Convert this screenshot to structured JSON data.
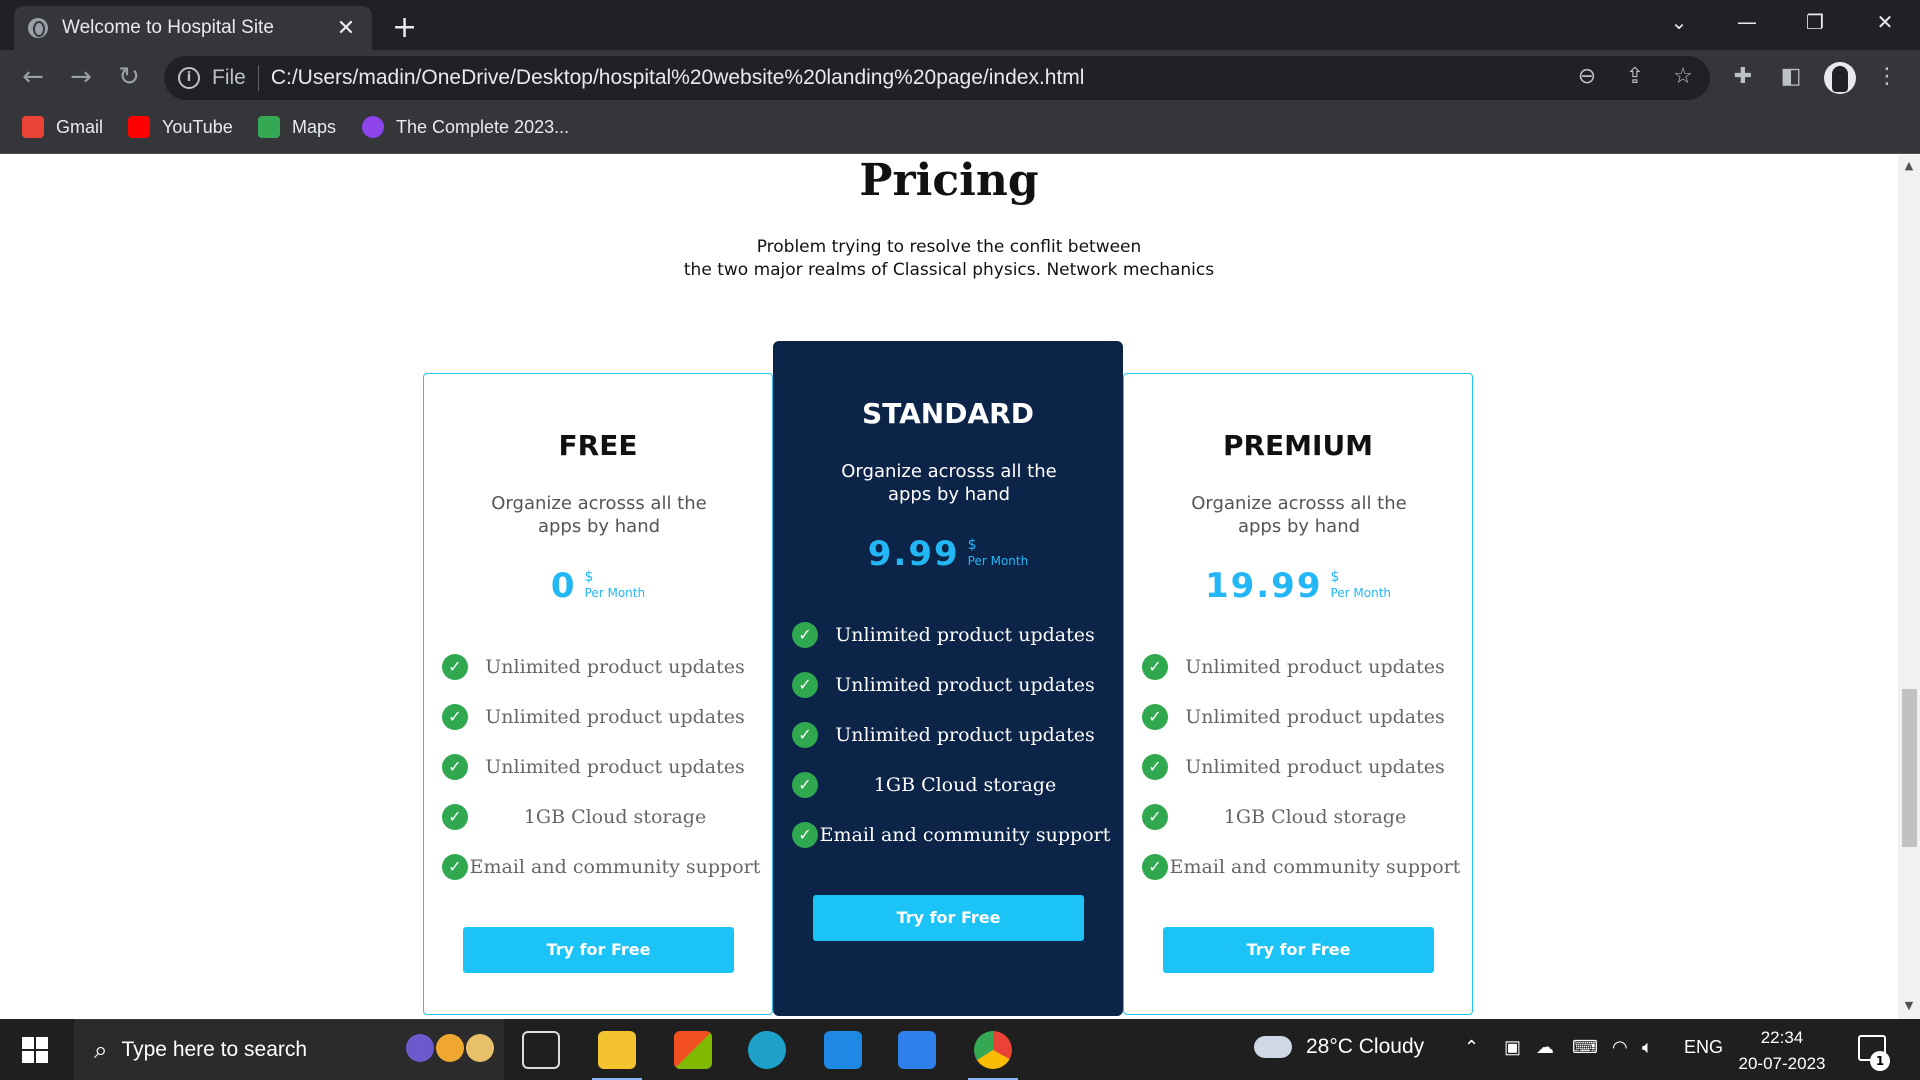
{
  "browser": {
    "tab_title": "Welcome to Hospital Site",
    "tab_close": "✕",
    "new_tab": "+",
    "file_label": "File",
    "url": "C:/Users/madin/OneDrive/Desktop/hospital%20website%20landing%20page/index.html",
    "bookmarks": [
      {
        "label": "Gmail",
        "color": "#ea4335"
      },
      {
        "label": "YouTube",
        "color": "#ff0000"
      },
      {
        "label": "Maps",
        "color": "#34a853"
      },
      {
        "label": "The Complete 2023...",
        "color": "#8e44ec"
      }
    ]
  },
  "pricing": {
    "title": "Pricing",
    "subtitle_line1": "Problem trying to resolve the conflit between",
    "subtitle_line2": "the two major realms of Classical physics. Network mechanics",
    "plans": [
      {
        "name": "FREE",
        "description": "Organize acrosss all the apps by hand",
        "price": "0",
        "currency": "$",
        "period": "Per Month",
        "featured": false,
        "features": [
          "Unlimited product updates",
          "Unlimited product updates",
          "Unlimited product updates",
          "1GB Cloud storage",
          "Email and community support"
        ],
        "cta": "Try for Free"
      },
      {
        "name": "STANDARD",
        "description": "Organize acrosss all the apps by hand",
        "price": "9.99",
        "currency": "$",
        "period": "Per Month",
        "featured": true,
        "features": [
          "Unlimited product updates",
          "Unlimited product updates",
          "Unlimited product updates",
          "1GB Cloud storage",
          "Email and community support"
        ],
        "cta": "Try for Free"
      },
      {
        "name": "PREMIUM",
        "description": "Organize acrosss all the apps by hand",
        "price": "19.99",
        "currency": "$",
        "period": "Per Month",
        "featured": false,
        "features": [
          "Unlimited product updates",
          "Unlimited product updates",
          "Unlimited product updates",
          "1GB Cloud storage",
          "Email and community support"
        ],
        "cta": "Try for Free"
      }
    ],
    "colors": {
      "accent": "#1cc3f6",
      "featured_bg": "#0b2447",
      "check": "#2fa84f"
    }
  },
  "taskbar": {
    "search_placeholder": "Type here to search",
    "weather": "28°C  Cloudy",
    "language": "ENG",
    "time": "22:34",
    "date": "20-07-2023",
    "notification_count": "1"
  }
}
